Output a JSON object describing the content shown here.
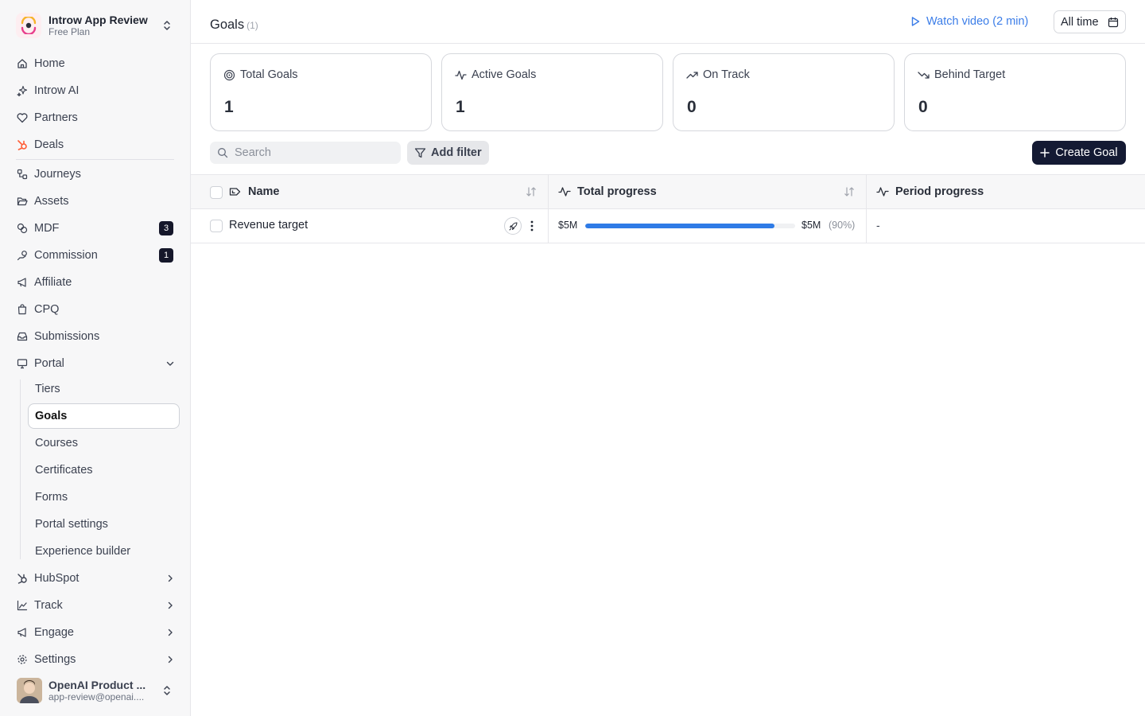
{
  "workspace": {
    "name": "Introw App Review",
    "plan": "Free Plan"
  },
  "nav": {
    "home": "Home",
    "ai": "Introw AI",
    "partners": "Partners",
    "deals": "Deals",
    "journeys": "Journeys",
    "assets": "Assets",
    "mdf": "MDF",
    "mdf_badge": "3",
    "commission": "Commission",
    "commission_badge": "1",
    "affiliate": "Affiliate",
    "cpq": "CPQ",
    "submissions": "Submissions",
    "portal": "Portal",
    "portal_sub": [
      "Tiers",
      "Goals",
      "Courses",
      "Certificates",
      "Forms",
      "Portal settings",
      "Experience builder"
    ],
    "hubspot": "HubSpot",
    "track": "Track",
    "engage": "Engage",
    "settings": "Settings"
  },
  "user": {
    "name": "OpenAI Product ...",
    "email": "app-review@openai...."
  },
  "header": {
    "title": "Goals",
    "count": "(1)",
    "watch": "Watch video (2 min)",
    "range": "All time"
  },
  "stats": [
    {
      "label": "Total Goals",
      "value": "1",
      "icon": "target-icon"
    },
    {
      "label": "Active Goals",
      "value": "1",
      "icon": "activity-icon"
    },
    {
      "label": "On Track",
      "value": "0",
      "icon": "trending-up-icon"
    },
    {
      "label": "Behind Target",
      "value": "0",
      "icon": "trending-down-icon"
    }
  ],
  "toolbar": {
    "search_placeholder": "Search",
    "filter": "Add filter",
    "create": "Create Goal"
  },
  "table": {
    "headers": {
      "name": "Name",
      "total": "Total progress",
      "period": "Period progress"
    },
    "rows": [
      {
        "name": "Revenue target",
        "start": "$5M",
        "target": "$5M",
        "percent": "(90%)",
        "progress": 0.9,
        "period": "-"
      }
    ]
  },
  "colors": {
    "accent": "#2f7be6",
    "primary_button": "#141a33",
    "link": "#3b7de8",
    "deals_icon": "#ff5c35"
  }
}
